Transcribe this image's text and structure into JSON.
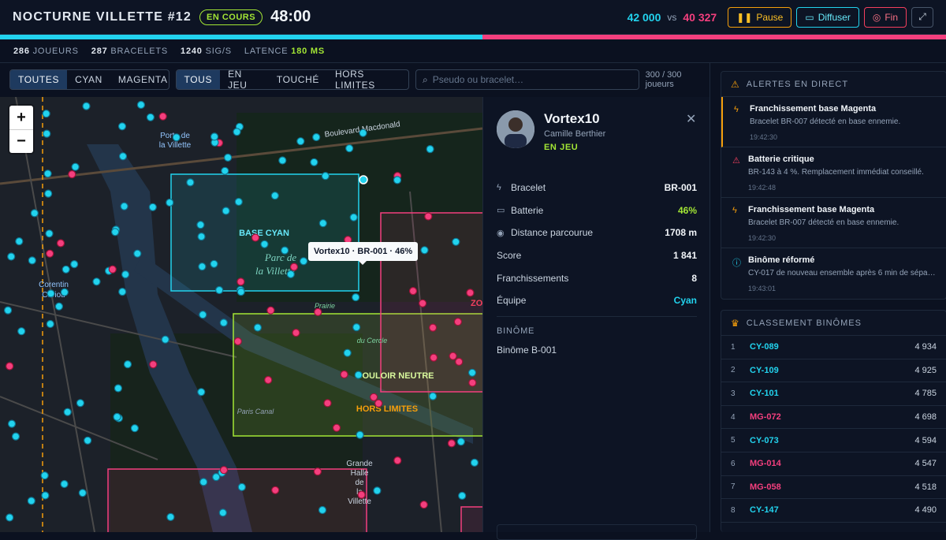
{
  "header": {
    "title": "NOCTURNE VILLETTE #12",
    "status_badge": "EN COURS",
    "timer": "48:00",
    "score_cyan": "42 000",
    "score_vs": "vs",
    "score_magenta": "40 327",
    "buttons": {
      "pause": "Pause",
      "diffuser": "Diffuser",
      "fin": "Fin"
    },
    "progress_cyan_percent": 51
  },
  "stats": [
    {
      "value": "286",
      "label": "JOUEURS"
    },
    {
      "value": "287",
      "label": "BRACELETS"
    },
    {
      "value": "1240",
      "label": "SIG/S"
    },
    {
      "label": "LATENCE",
      "value": "180 MS"
    }
  ],
  "filters": {
    "teams": [
      "TOUTES",
      "CYAN",
      "MAGENTA"
    ],
    "states": [
      "TOUS",
      "EN JEU",
      "TOUCHÉ",
      "HORS LIMITES"
    ],
    "search_placeholder": "Pseudo ou bracelet…",
    "count": "300 / 300 joueurs"
  },
  "map": {
    "zoom_in": "+",
    "zoom_out": "−",
    "tooltip": "Vortex10 · BR-001 · 46%",
    "labels": {
      "base_cyan": "BASE CYAN",
      "couloir": "COULOIR NEUTRE",
      "hors_limites": "HORS LIMITES",
      "zone_partial": "ZO",
      "parc": "Parc de",
      "parc2": "la Villette",
      "porte": "Porte de",
      "porte2": "la Villette",
      "corentin": "Corentin",
      "corentin2": "Cariou",
      "boulevard": "Boulevard Macdonald",
      "grande_halle": "Grande",
      "grande_halle2": "Halle",
      "grande_halle3": "de",
      "grande_halle4": "la",
      "grande_halle5": "Villette",
      "prairie": "Prairie",
      "prairie2": "du Cercle",
      "paris_canal": "Paris Canal"
    }
  },
  "player": {
    "name": "Vortex10",
    "real_name": "Camille Berthier",
    "status": "EN JEU",
    "fields": [
      {
        "label": "Bracelet",
        "value": "BR-001",
        "icon": "bolt-icon"
      },
      {
        "label": "Batterie",
        "value": "46%",
        "icon": "battery-icon"
      },
      {
        "label": "Distance parcourue",
        "value": "1708 m",
        "icon": "pin-icon"
      },
      {
        "label": "Score",
        "value": "1 841"
      },
      {
        "label": "Franchissements",
        "value": "8"
      },
      {
        "label": "Équipe",
        "value": "Cyan"
      }
    ],
    "binome_header": "BINÔME",
    "binome_value": "Binôme B-001"
  },
  "alerts": {
    "title": "ALERTES EN DIRECT",
    "items": [
      {
        "title": "Franchissement base Magenta",
        "desc": "Bracelet BR-007 détecté en base ennemie.",
        "time": "19:42:30",
        "icon": "bolt-icon",
        "color": "#f59e0b"
      },
      {
        "title": "Batterie critique",
        "desc": "BR-143 à 4 %. Remplacement immédiat conseillé.",
        "time": "19:42:48",
        "icon": "warning-icon",
        "color": "#f43f5e"
      },
      {
        "title": "Franchissement base Magenta",
        "desc": "Bracelet BR-007 détecté en base ennemie.",
        "time": "19:42:30",
        "icon": "bolt-icon",
        "color": "#f59e0b"
      },
      {
        "title": "Binôme réformé",
        "desc": "CY-017 de nouveau ensemble après 6 min de sépa…",
        "time": "19:43:01",
        "icon": "info-icon",
        "color": "#22d3ee"
      }
    ]
  },
  "ranking": {
    "title": "CLASSEMENT BINÔMES",
    "items": [
      {
        "rank": "1",
        "team": "CY-089",
        "score": "4 934",
        "side": "cy"
      },
      {
        "rank": "2",
        "team": "CY-109",
        "score": "4 925",
        "side": "cy"
      },
      {
        "rank": "3",
        "team": "CY-101",
        "score": "4 785",
        "side": "cy"
      },
      {
        "rank": "4",
        "team": "MG-072",
        "score": "4 698",
        "side": "mg"
      },
      {
        "rank": "5",
        "team": "CY-073",
        "score": "4 594",
        "side": "cy"
      },
      {
        "rank": "6",
        "team": "MG-014",
        "score": "4 547",
        "side": "mg"
      },
      {
        "rank": "7",
        "team": "MG-058",
        "score": "4 518",
        "side": "mg"
      },
      {
        "rank": "8",
        "team": "CY-147",
        "score": "4 490",
        "side": "cy"
      }
    ]
  },
  "colors": {
    "cyan": "#22d3ee",
    "magenta": "#f43f7e",
    "lime": "#a3e635",
    "amber": "#f59e0b"
  }
}
